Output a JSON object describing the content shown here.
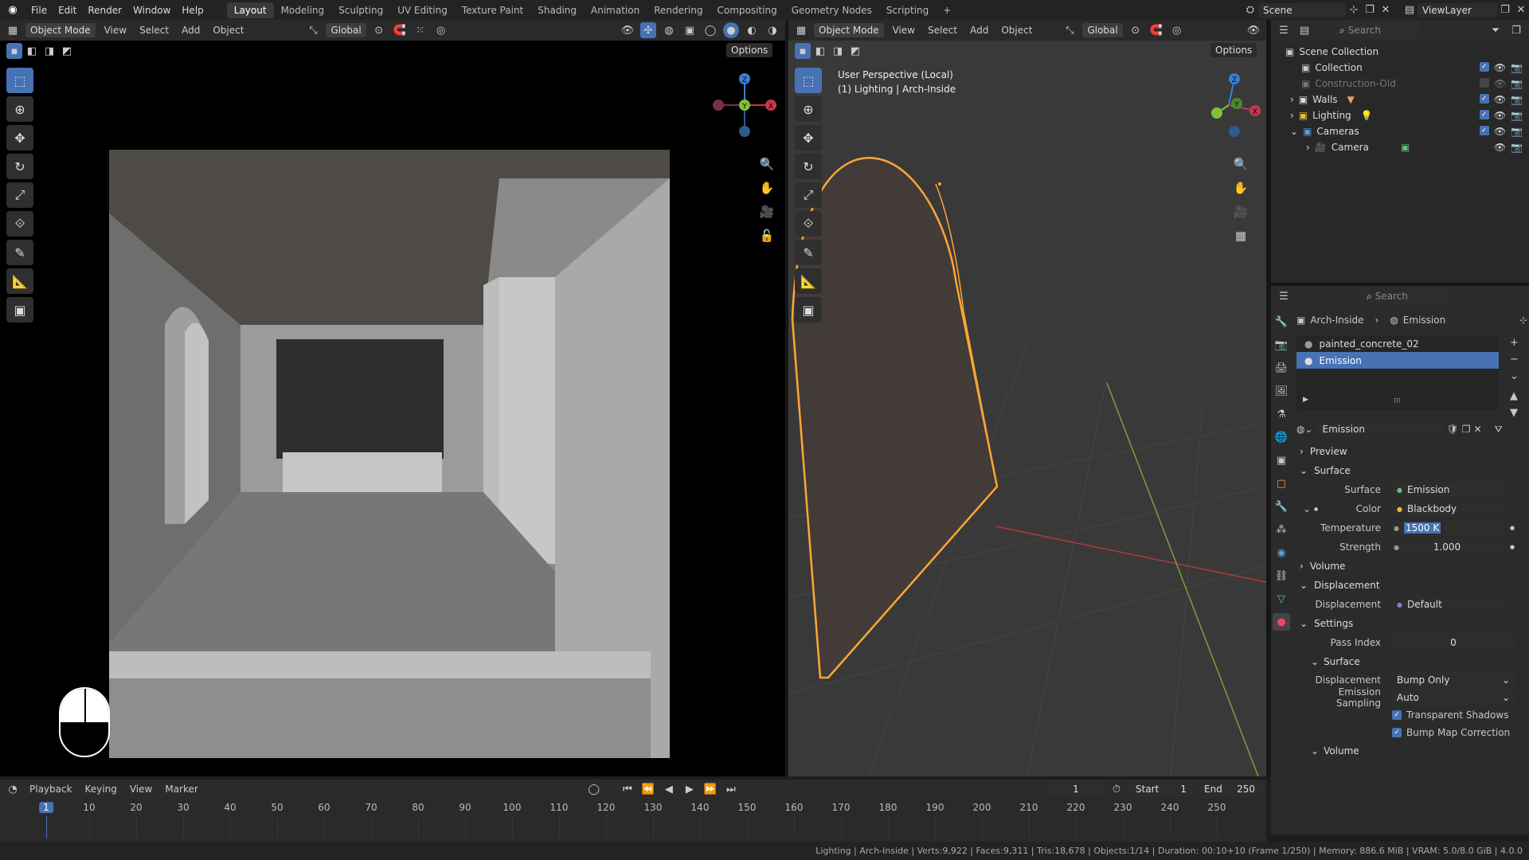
{
  "topbar": {
    "menus": [
      "File",
      "Edit",
      "Render",
      "Window",
      "Help"
    ],
    "workspaces": [
      "Layout",
      "Modeling",
      "Sculpting",
      "UV Editing",
      "Texture Paint",
      "Shading",
      "Animation",
      "Rendering",
      "Compositing",
      "Geometry Nodes",
      "Scripting"
    ],
    "active_workspace": "Layout",
    "add": "+",
    "scene": "Scene",
    "viewlayer": "ViewLayer"
  },
  "viewport_left": {
    "mode": "Object Mode",
    "menus": [
      "View",
      "Select",
      "Add",
      "Object"
    ],
    "orientation": "Global",
    "options": "Options"
  },
  "viewport_right": {
    "mode": "Object Mode",
    "menus": [
      "View",
      "Select",
      "Add",
      "Object"
    ],
    "orientation": "Global",
    "options": "Options",
    "overlay_line1": "User Perspective (Local)",
    "overlay_line2": "(1) Lighting | Arch-Inside"
  },
  "gizmo": {
    "x": "X",
    "y": "Y",
    "z": "Z"
  },
  "outliner": {
    "search_placeholder": "Search",
    "items": [
      {
        "label": "Scene Collection",
        "depth": 0,
        "icon": "collection-icon"
      },
      {
        "label": "Collection",
        "depth": 1
      },
      {
        "label": "Construction-Old",
        "depth": 1,
        "dim": true
      },
      {
        "label": "Walls",
        "depth": 1
      },
      {
        "label": "Lighting",
        "depth": 1
      },
      {
        "label": "Cameras",
        "depth": 1
      },
      {
        "label": "Camera",
        "depth": 2
      }
    ]
  },
  "properties": {
    "search_placeholder": "Search",
    "breadcrumb_object": "Arch-Inside",
    "breadcrumb_material": "Emission",
    "slots": [
      "painted_concrete_02",
      "Emission"
    ],
    "active_slot": 1,
    "material_name": "Emission",
    "panels": {
      "preview": "Preview",
      "surface": "Surface",
      "volume": "Volume",
      "displacement": "Displacement",
      "settings": "Settings",
      "surface_sub": "Surface",
      "volume_sub": "Volume"
    },
    "surface_label": "Surface",
    "surface_value": "Emission",
    "color_label": "Color",
    "color_value": "Blackbody",
    "temperature_label": "Temperature",
    "temperature_value": "1500 K",
    "strength_label": "Strength",
    "strength_value": "1.000",
    "displacement_label": "Displacement",
    "displacement_value": "Default",
    "pass_index_label": "Pass Index",
    "pass_index_value": "0",
    "disp_method_label": "Displacement",
    "disp_method_value": "Bump Only",
    "emission_sampling_label": "Emission Sampling",
    "emission_sampling_value": "Auto",
    "transparent_shadows": "Transparent Shadows",
    "bump_map_correction": "Bump Map Correction"
  },
  "timeline": {
    "menus": [
      "Playback",
      "Keying",
      "View",
      "Marker"
    ],
    "current_frame": "1",
    "start_label": "Start",
    "start": "1",
    "end_label": "End",
    "end": "250",
    "ticks": [
      "1",
      "10",
      "20",
      "30",
      "40",
      "50",
      "60",
      "70",
      "80",
      "90",
      "100",
      "110",
      "120",
      "130",
      "140",
      "150",
      "160",
      "170",
      "180",
      "190",
      "200",
      "210",
      "220",
      "230",
      "240",
      "250"
    ]
  },
  "statusbar": {
    "text": "Lighting | Arch-Inside | Verts:9,922 | Faces:9,311 | Tris:18,678 | Objects:1/14 | Duration: 00:10+10 (Frame 1/250) | Memory: 886.6 MiB | VRAM: 5.0/8.0 GiB | 4.0.0"
  },
  "colors": {
    "accent": "#4772b3",
    "selection": "#ffa733",
    "x_axis": "#c8374a",
    "y_axis": "#7ec13a",
    "z_axis": "#3b7ed4"
  }
}
